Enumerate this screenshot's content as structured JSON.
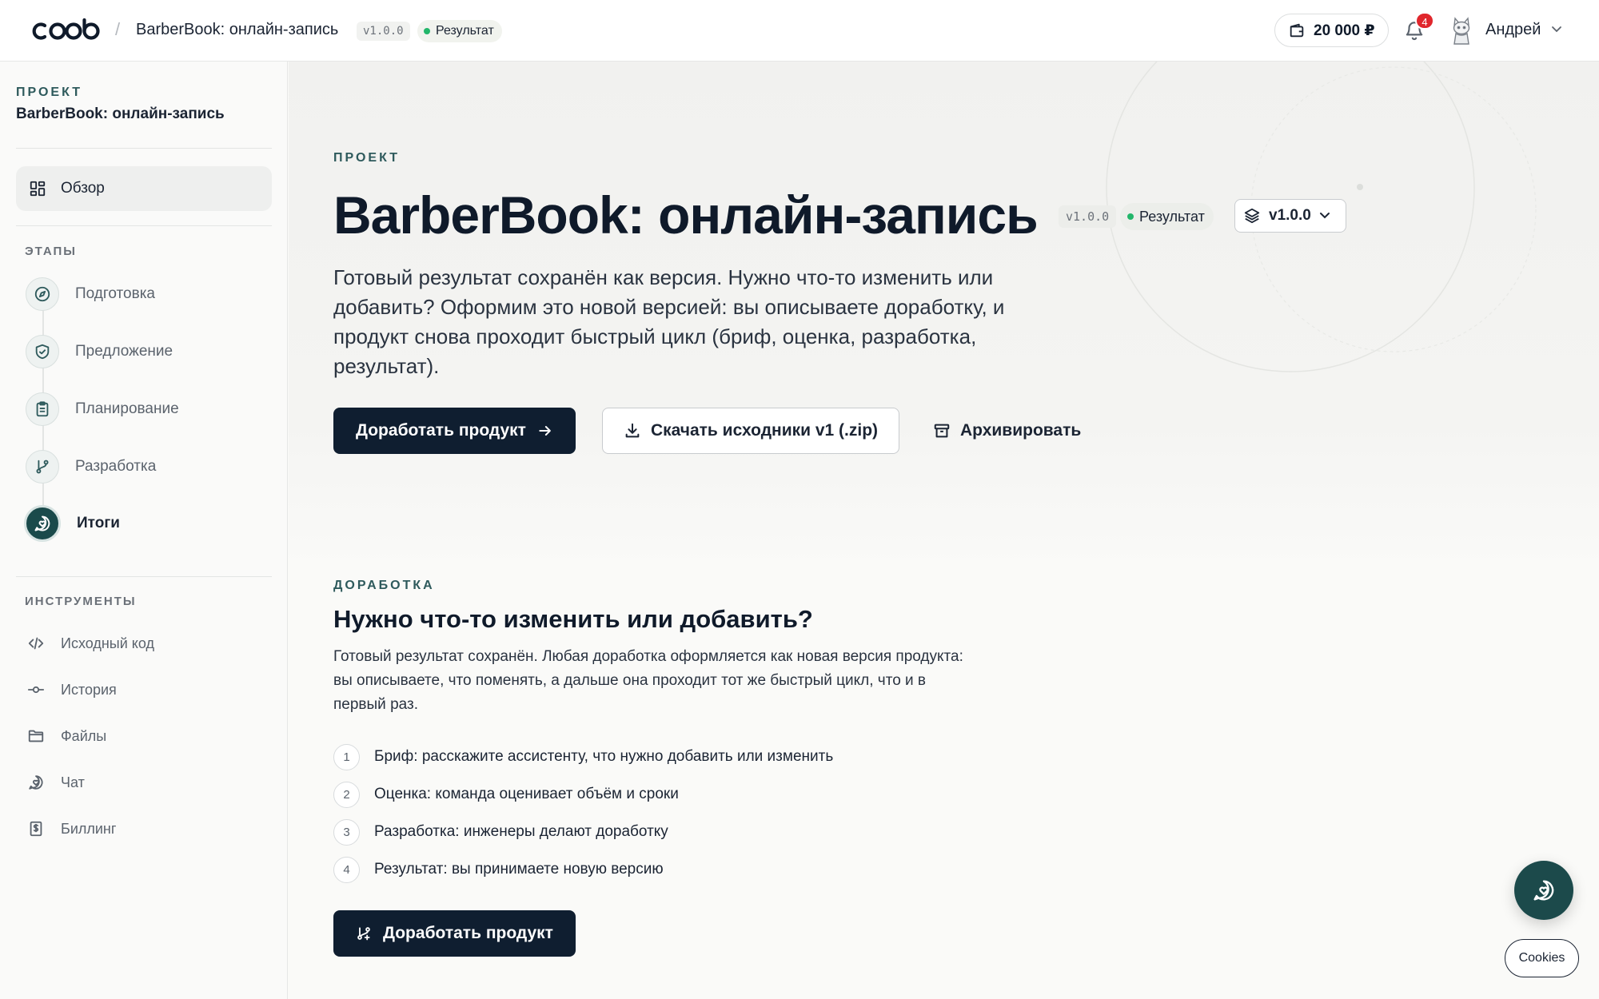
{
  "header": {
    "logo_text": "coob",
    "breadcrumb_title": "BarberBook: онлайн-запись",
    "version": "v1.0.0",
    "status": "Результат",
    "balance": "20 000 ₽",
    "notifications_count": "4",
    "user_name": "Андрей"
  },
  "sidebar": {
    "project_label": "ПРОЕКТ",
    "project_name": "BarberBook: онлайн-запись",
    "overview": "Обзор",
    "stages_label": "ЭТАПЫ",
    "stages": [
      {
        "label": "Подготовка",
        "icon": "compass-icon"
      },
      {
        "label": "Предложение",
        "icon": "handshake-shield-icon"
      },
      {
        "label": "Планирование",
        "icon": "clipboard-icon"
      },
      {
        "label": "Разработка",
        "icon": "git-branch-icon"
      },
      {
        "label": "Итоги",
        "icon": "chat-heart-icon",
        "active": true
      }
    ],
    "tools_label": "ИНСТРУМЕНТЫ",
    "tools": [
      {
        "label": "Исходный код",
        "icon": "code-icon"
      },
      {
        "label": "История",
        "icon": "commit-icon"
      },
      {
        "label": "Файлы",
        "icon": "folder-icon"
      },
      {
        "label": "Чат",
        "icon": "chat-icon"
      },
      {
        "label": "Биллинг",
        "icon": "receipt-icon"
      }
    ]
  },
  "hero": {
    "eyebrow": "ПРОЕКТ",
    "title": "BarberBook: онлайн-запись",
    "version": "v1.0.0",
    "status": "Результат",
    "version_select": "v1.0.0",
    "description": "Готовый результат сохранён как версия. Нужно что-то изменить или добавить? Оформим это новой версией: вы описываете доработку, и продукт снова проходит быстрый цикл (бриф, оценка, разработка, результат).",
    "btn_improve": "Доработать продукт",
    "btn_download": "Скачать исходники v1 (.zip)",
    "btn_archive": "Архивировать"
  },
  "improve": {
    "eyebrow": "ДОРАБОТКА",
    "title": "Нужно что-то изменить или добавить?",
    "description": "Готовый результат сохранён. Любая доработка оформляется как новая версия продукта: вы описываете, что поменять, а дальше она проходит тот же быстрый цикл, что и в первый раз.",
    "steps": [
      {
        "num": "1",
        "text": "Бриф: расскажите ассистенту, что нужно добавить или изменить"
      },
      {
        "num": "2",
        "text": "Оценка: команда оценивает объём и сроки"
      },
      {
        "num": "3",
        "text": "Разработка: инженеры делают доработку"
      },
      {
        "num": "4",
        "text": "Результат: вы принимаете новую версию"
      }
    ],
    "btn_improve": "Доработать продукт"
  },
  "cookies_label": "Cookies",
  "colors": {
    "primary": "#0f1e30",
    "accent": "#1a4a4b",
    "status_green": "#22b66a",
    "badge_red": "#e0262c"
  }
}
